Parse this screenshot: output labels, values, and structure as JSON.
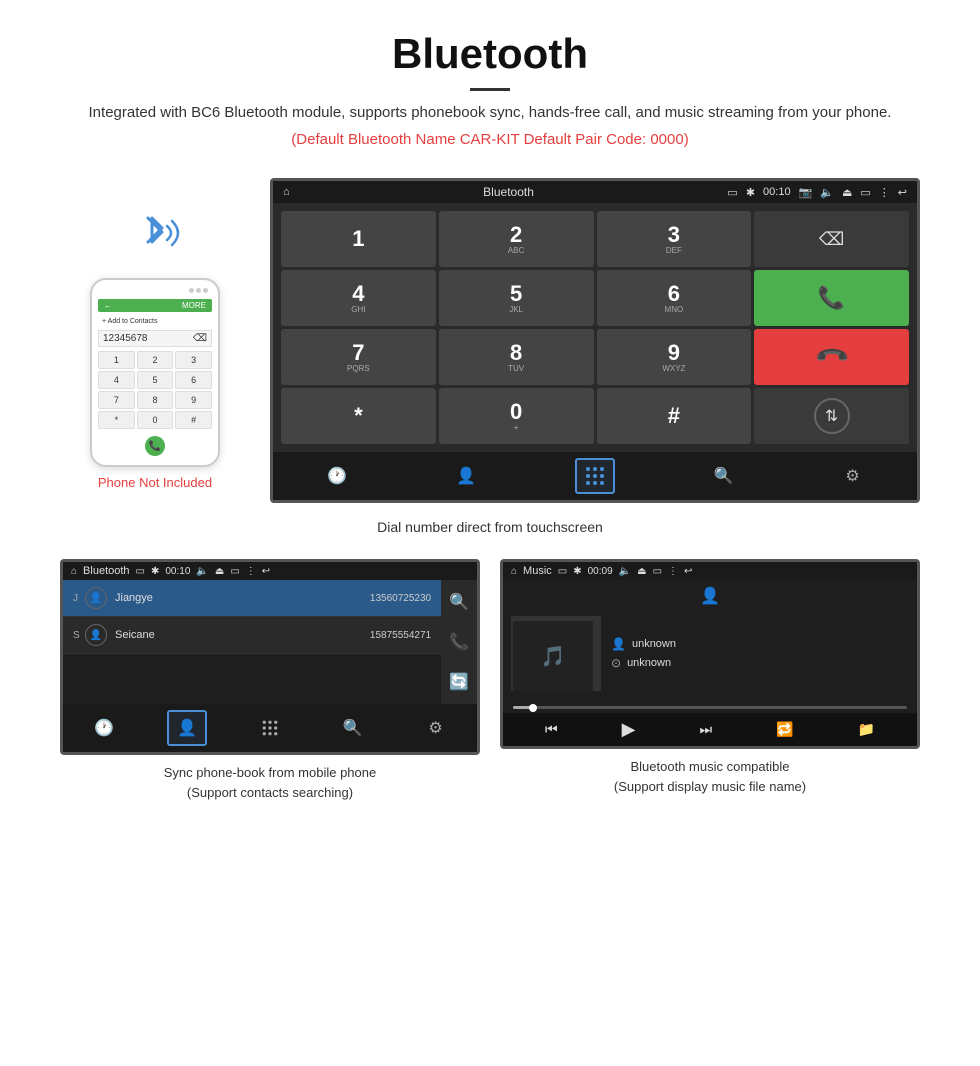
{
  "page": {
    "title": "Bluetooth",
    "description": "Integrated with BC6 Bluetooth module, supports phonebook sync, hands-free call, and music streaming from your phone.",
    "red_note": "(Default Bluetooth Name CAR-KIT     Default Pair Code: 0000)",
    "phone_not_included": "Phone Not Included",
    "dial_caption": "Dial number direct from touchscreen",
    "phonebook_caption_line1": "Sync phone-book from mobile phone",
    "phonebook_caption_line2": "(Support contacts searching)",
    "music_caption_line1": "Bluetooth music compatible",
    "music_caption_line2": "(Support display music file name)"
  },
  "car_screen": {
    "header_title": "Bluetooth",
    "time": "00:10",
    "dial_keys": [
      {
        "num": "1",
        "letters": ""
      },
      {
        "num": "2",
        "letters": "ABC"
      },
      {
        "num": "3",
        "letters": "DEF"
      },
      {
        "num": "4",
        "letters": "GHI"
      },
      {
        "num": "5",
        "letters": "JKL"
      },
      {
        "num": "6",
        "letters": "MNO"
      },
      {
        "num": "7",
        "letters": "PQRS"
      },
      {
        "num": "8",
        "letters": "TUV"
      },
      {
        "num": "9",
        "letters": "WXYZ"
      },
      {
        "num": "*",
        "letters": ""
      },
      {
        "num": "0",
        "letters": "+"
      },
      {
        "num": "#",
        "letters": ""
      }
    ]
  },
  "phonebook_screen": {
    "header_title": "Bluetooth",
    "time": "00:10",
    "contacts": [
      {
        "letter": "J",
        "name": "Jiangye",
        "number": "13560725230",
        "highlighted": true
      },
      {
        "letter": "S",
        "name": "Seicane",
        "number": "15875554271",
        "highlighted": false
      }
    ]
  },
  "music_screen": {
    "header_title": "Music",
    "time": "00:09",
    "artist1": "unknown",
    "artist2": "unknown"
  },
  "phone_mockup": {
    "number": "12345678",
    "keys": [
      "1",
      "2",
      "3",
      "4",
      "5",
      "6",
      "7",
      "8",
      "9",
      "*",
      "0",
      "#"
    ]
  }
}
